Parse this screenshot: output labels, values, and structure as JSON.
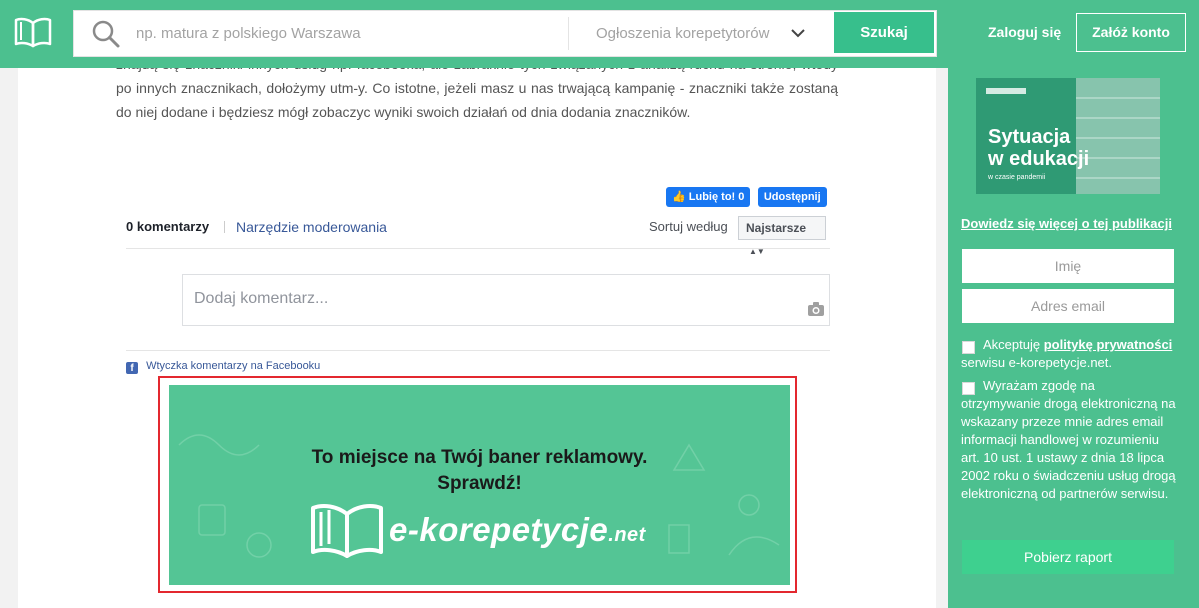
{
  "header": {
    "search_placeholder": "np. matura z polskiego Warszawa",
    "category": "Ogłoszenia korepetytorów",
    "search_button": "Szukaj",
    "login": "Zaloguj się",
    "register": "Załóż konto"
  },
  "article": {
    "text": "znajdą się znaczniki innych usług np. facebooka, ale zabraknie tych związanych z analizą ruchu na stronie, wtedy po innych znacznikach, dołożymy utm-y. Co istotne, jeżeli masz u nas trwającą kampanię - znaczniki także zostaną do niej dodane i będziesz mógł zobaczyc wyniki swoich działań od dnia dodania znaczników."
  },
  "social": {
    "like": "Lubię to! 0",
    "share": "Udostępnij"
  },
  "comments": {
    "count": "0 komentarzy",
    "moderation": "Narzędzie moderowania",
    "sort_label": "Sortuj według",
    "sort_value": "Najstarsze",
    "placeholder": "Dodaj komentarz...",
    "plugin": "Wtyczka komentarzy na Facebooku"
  },
  "banner": {
    "line1": "To miejsce na Twój baner reklamowy.",
    "line2": "Sprawdź!",
    "logo_main": "e-korepetycje",
    "logo_tld": ".net"
  },
  "sidebar": {
    "promo_title_1": "Sytuacja",
    "promo_title_2": "w edukacji",
    "promo_sub": "w czasie pandemii",
    "more_link": "Dowiedz się więcej o tej publikacji",
    "name_placeholder": "Imię",
    "email_placeholder": "Adres email",
    "privacy_pre": "Akceptuję ",
    "privacy_link": "politykę prywatności",
    "privacy_post": " serwisu e-korepetycje.net.",
    "marketing": "Wyrażam zgodę na otrzymywanie drogą elektroniczną na wskazany przeze mnie adres email informacji handlowej w rozumieniu art. 10 ust. 1 ustawy z dnia 18 lipca 2002 roku o świadczeniu usług drogą elektroniczną od partnerów serwisu.",
    "report_button": "Pobierz raport"
  }
}
